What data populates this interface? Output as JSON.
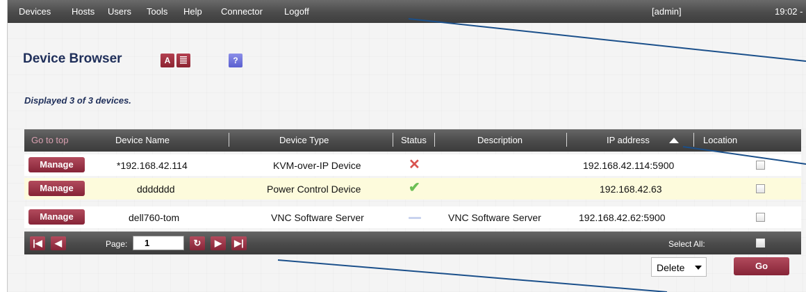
{
  "menu": {
    "items": [
      "Devices",
      "Hosts",
      "Users",
      "Tools",
      "Help",
      "Connector",
      "Logoff"
    ],
    "user": "[admin]",
    "time": "19:02 -"
  },
  "page": {
    "title": "Device Browser",
    "icon_a_label": "A",
    "help_label": "?",
    "displayed": "Displayed 3 of 3 devices."
  },
  "table": {
    "go_to_top": "Go to top",
    "headers": {
      "name": "Device Name",
      "type": "Device Type",
      "status": "Status",
      "description": "Description",
      "ip": "IP address",
      "location": "Location"
    },
    "manage_label": "Manage",
    "rows": [
      {
        "name": "*192.168.42.114",
        "type": "KVM-over-IP Device",
        "status": "x-icon",
        "description": "",
        "ip": "192.168.42.114:5900"
      },
      {
        "name": "ddddddd",
        "type": "Power Control Device",
        "status": "checkmark-icon",
        "description": "",
        "ip": "192.168.42.63"
      },
      {
        "name": "dell760-tom",
        "type": "VNC Software Server",
        "status": "unknown-status-icon",
        "description": "VNC Software Server",
        "ip": "192.168.42.62:5900"
      }
    ]
  },
  "pager": {
    "page_label": "Page:",
    "page_value": "1",
    "select_all": "Select All:"
  },
  "actions": {
    "selected": "Delete",
    "go": "Go"
  },
  "colors": {
    "accent": "#8c2a3d",
    "header_bar": "#4a4a4a",
    "title": "#1f2f5a",
    "highlight_row": "#fdfbdc",
    "callout_line": "#1a4f8a"
  }
}
